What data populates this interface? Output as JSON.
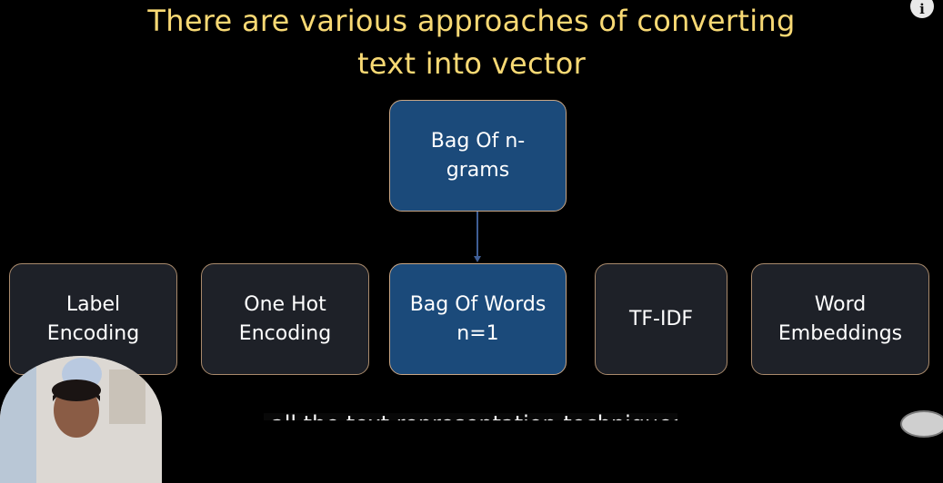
{
  "slide": {
    "title_line1": "There are various approaches of converting",
    "title_line2": "text into vector"
  },
  "diagram": {
    "top_box": {
      "line1": "Bag Of n-",
      "line2": "grams"
    },
    "boxes": [
      {
        "line1": "Label",
        "line2": "Encoding"
      },
      {
        "line1": "One Hot",
        "line2": "Encoding"
      },
      {
        "line1": "Bag Of Words",
        "line2": "n=1"
      },
      {
        "line1": "TF-IDF",
        "line2": ""
      },
      {
        "line1": "Word",
        "line2": "Embeddings"
      }
    ]
  },
  "player": {
    "info_icon": "info-icon",
    "subtitle": "all the text representation techniques"
  },
  "colors": {
    "background": "#000000",
    "title": "#f8d974",
    "box_dark": "#1e2128",
    "box_blue": "#1b4a7a",
    "box_border": "#a98a6c",
    "connector": "#3f5e95"
  }
}
